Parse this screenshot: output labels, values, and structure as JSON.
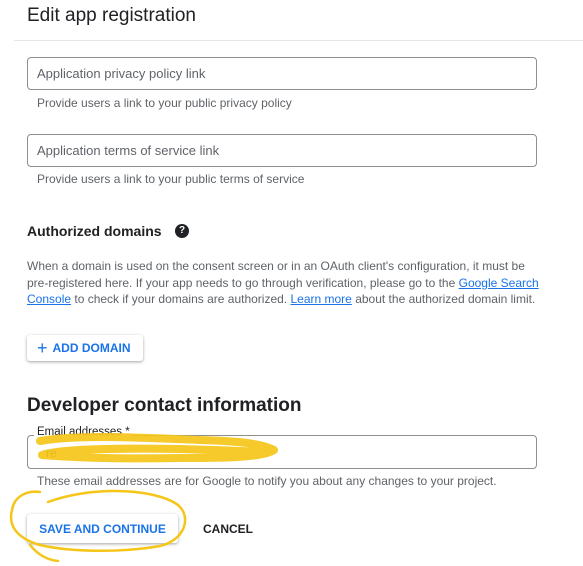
{
  "page": {
    "title": "Edit app registration"
  },
  "privacy": {
    "placeholder": "Application privacy policy link",
    "hint": "Provide users a link to your public privacy policy"
  },
  "terms": {
    "placeholder": "Application terms of service link",
    "hint": "Provide users a link to your public terms of service"
  },
  "authorized_domains": {
    "heading": "Authorized domains",
    "help_icon": "?",
    "text_1": "When a domain is used on the consent screen or in an OAuth client's configuration, it must be pre-registered here. If your app needs to go through verification, please go to the ",
    "link_console": "Google Search Console",
    "text_2": " to check if your domains are authorized. ",
    "link_learn": "Learn more",
    "text_3": " about the authorized domain limit.",
    "add_button": "ADD DOMAIN",
    "add_icon": "+"
  },
  "developer": {
    "heading": "Developer contact information",
    "email_label": "Email addresses *",
    "email_value": "re",
    "hint": "These email addresses are for Google to notify you about any changes to your project."
  },
  "actions": {
    "save": "SAVE AND CONTINUE",
    "cancel": "CANCEL"
  },
  "colors": {
    "accent": "#1a73e8",
    "annotation": "#f5c518"
  }
}
